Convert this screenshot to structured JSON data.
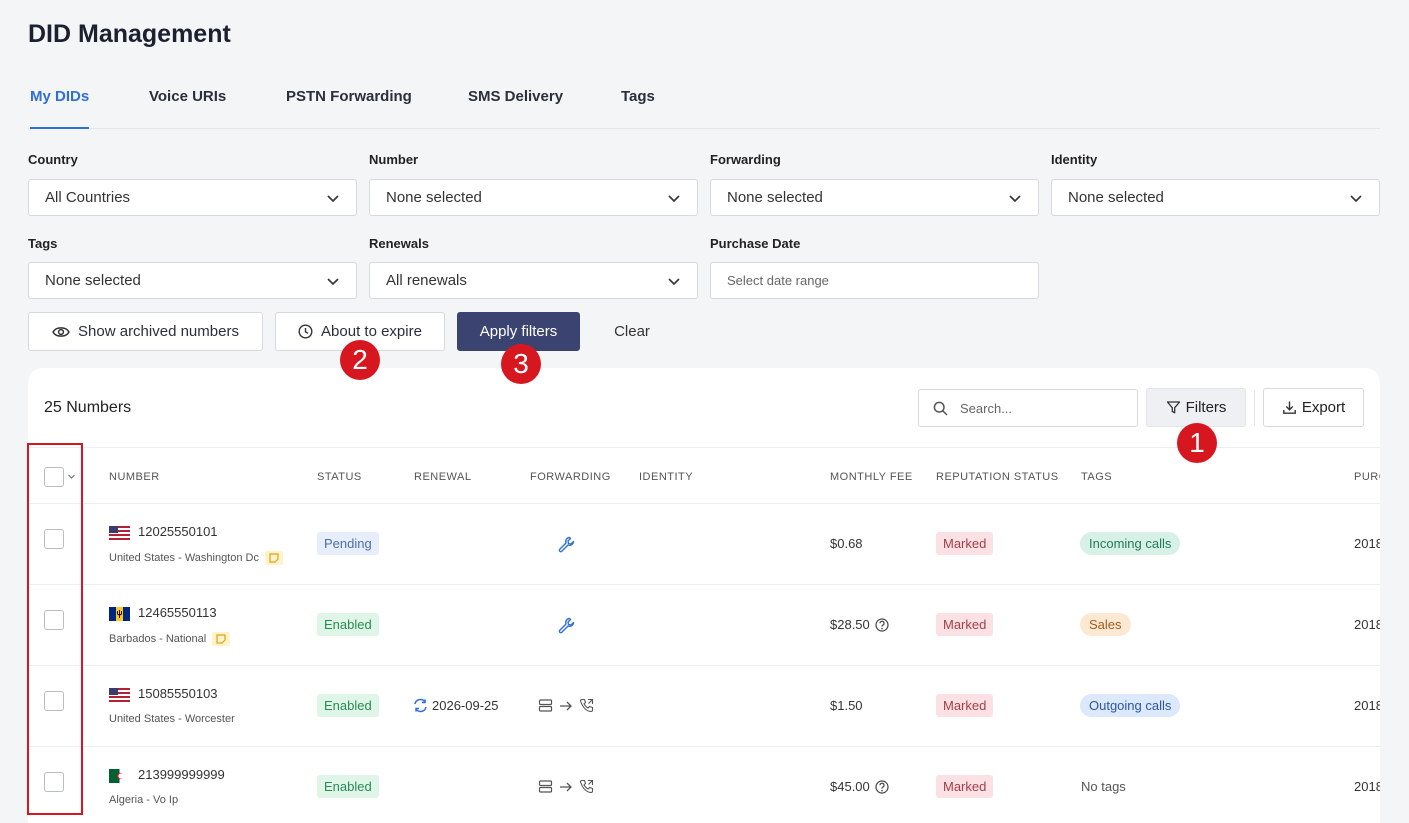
{
  "page": {
    "title": "DID Management"
  },
  "tabs": [
    {
      "label": "My DIDs",
      "active": true
    },
    {
      "label": "Voice URIs",
      "active": false
    },
    {
      "label": "PSTN Forwarding",
      "active": false
    },
    {
      "label": "SMS Delivery",
      "active": false
    },
    {
      "label": "Tags",
      "active": false
    }
  ],
  "filters": {
    "country": {
      "label": "Country",
      "value": "All Countries"
    },
    "number": {
      "label": "Number",
      "value": "None selected"
    },
    "forwarding": {
      "label": "Forwarding",
      "value": "None selected"
    },
    "identity": {
      "label": "Identity",
      "value": "None selected"
    },
    "tags": {
      "label": "Tags",
      "value": "None selected"
    },
    "renewals": {
      "label": "Renewals",
      "value": "All renewals"
    },
    "purchase_date": {
      "label": "Purchase Date",
      "placeholder": "Select date range"
    }
  },
  "actions": {
    "show_archived": "Show archived numbers",
    "about_to_expire": "About to expire",
    "apply_filters": "Apply filters",
    "clear": "Clear"
  },
  "annotations": {
    "one": "1",
    "two": "2",
    "three": "3"
  },
  "table": {
    "count_label": "25 Numbers",
    "search_placeholder": "Search...",
    "filters_label": "Filters",
    "export_label": "Export",
    "columns": {
      "number": "NUMBER",
      "status": "STATUS",
      "renewal": "RENEWAL",
      "forwarding": "FORWARDING",
      "identity": "IDENTITY",
      "monthly_fee": "MONTHLY FEE",
      "reputation": "REPUTATION STATUS",
      "tags": "TAGS",
      "purchase": "PURC"
    },
    "rows": [
      {
        "number": "12025550101",
        "location": "United States - Washington Dc",
        "flag": "us",
        "status": "Pending",
        "renewal": "",
        "forwarding": "wrench",
        "fee": "$0.68",
        "fee_help": false,
        "reputation": "Marked",
        "tag": "Incoming calls",
        "purchase": "2018"
      },
      {
        "number": "12465550113",
        "location": "Barbados - National",
        "flag": "bb",
        "status": "Enabled",
        "renewal": "",
        "forwarding": "wrench",
        "fee": "$28.50",
        "fee_help": true,
        "reputation": "Marked",
        "tag": "Sales",
        "purchase": "2018"
      },
      {
        "number": "15085550103",
        "location": "United States - Worcester",
        "flag": "us",
        "status": "Enabled",
        "renewal": "2026-09-25",
        "forwarding": "server-to-phone",
        "fee": "$1.50",
        "fee_help": false,
        "reputation": "Marked",
        "tag": "Outgoing calls",
        "purchase": "2018"
      },
      {
        "number": "213999999999",
        "location": "Algeria - Vo Ip",
        "flag": "dz",
        "status": "Enabled",
        "renewal": "",
        "forwarding": "server-to-phone",
        "fee": "$45.00",
        "fee_help": true,
        "reputation": "Marked",
        "tag": "No tags",
        "purchase": "2018"
      }
    ]
  },
  "colors": {
    "accent": "#2f6fd6",
    "primary_button": "#3b4470",
    "annotation_red": "#d7171f"
  }
}
